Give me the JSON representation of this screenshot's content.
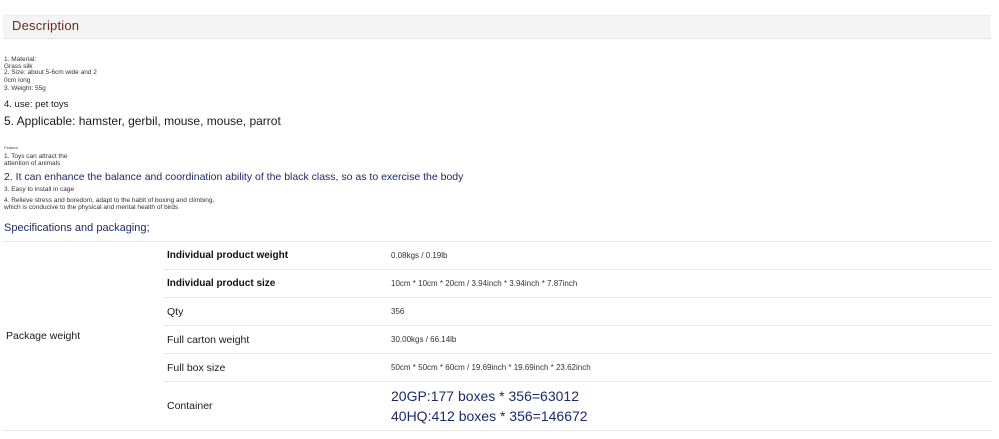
{
  "description": {
    "header": "Description",
    "lines": [
      "1. Material:",
      "Grass silk",
      "2. Size: about 5-6cm wide and 2",
      "0cm long",
      "3. Weight: 55g",
      "4. use: pet toys",
      "5. Applicable: hamster, gerbil, mouse, mouse, parrot"
    ],
    "features_label": "Feature:",
    "features": [
      "1. Toys can attract the",
      "attention of animals",
      "2. It can enhance the balance and coordination ability of the black class, so as to exercise the body",
      "3. Easy to install in cage",
      "4. Relieve stress and boredom, adapt to the habit of boxing and climbing,",
      "which is conducive to the physical and mental health of birds"
    ]
  },
  "specs": {
    "title": "Specifications and packaging;",
    "group_label": "Package weight",
    "rows": [
      {
        "label": "Individual product weight",
        "value": "0.08kgs / 0.19lb"
      },
      {
        "label": "Individual product size",
        "value": "10cm * 10cm * 20cm / 3.94inch * 3.94inch * 7.87inch"
      },
      {
        "label": "Qty",
        "value": "356"
      },
      {
        "label": "Full carton weight",
        "value": "30.00kgs / 66.14lb"
      },
      {
        "label": "Full box size",
        "value": "50cm * 50cm * 60cm / 19.69inch * 19.69inch * 23.62inch"
      },
      {
        "label": "Container",
        "value_lines": [
          "20GP:177 boxes * 356=63012",
          "40HQ:412 boxes * 356=146672"
        ]
      }
    ]
  }
}
